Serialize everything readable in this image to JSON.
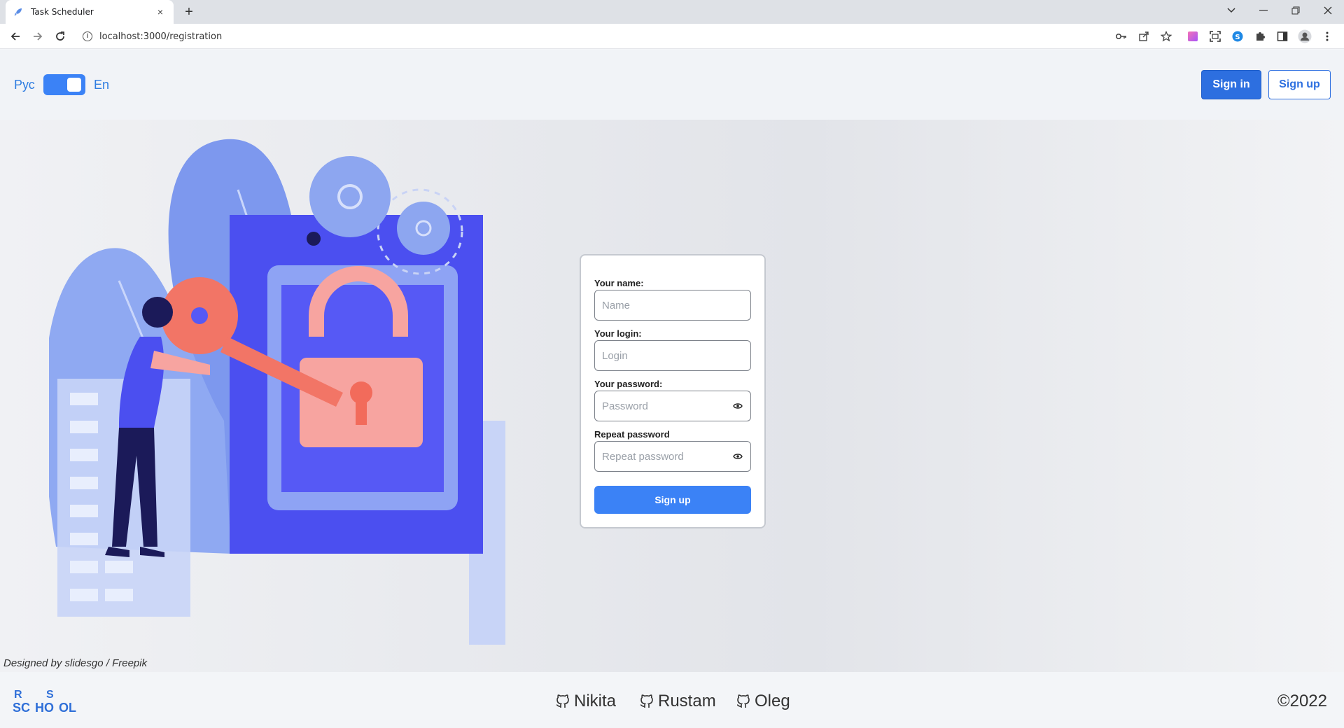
{
  "browser": {
    "tab_title": "Task Scheduler",
    "tab_close": "×",
    "new_tab": "+",
    "url": "localhost:3000/registration",
    "icons": [
      "key-icon",
      "share-icon",
      "star-icon",
      "extension-color-icon",
      "screenshot-icon",
      "skype-icon",
      "puzzle-icon",
      "sidepanel-icon",
      "profile-icon",
      "menu-icon"
    ]
  },
  "header": {
    "lang_ru": "Рус",
    "lang_en": "En",
    "sign_in": "Sign in",
    "sign_up": "Sign up",
    "accent_color": "#3b82f6"
  },
  "form": {
    "name_label": "Your name:",
    "name_placeholder": "Name",
    "login_label": "Your login:",
    "login_placeholder": "Login",
    "password_label": "Your password:",
    "password_placeholder": "Password",
    "repeat_label": "Repeat password",
    "repeat_placeholder": "Repeat password",
    "submit": "Sign up"
  },
  "credit": "Designed by slidesgo / Freepik",
  "footer": {
    "developers": [
      "Nikita",
      "Rustam",
      "Oleg"
    ],
    "copyright": "©2022"
  }
}
